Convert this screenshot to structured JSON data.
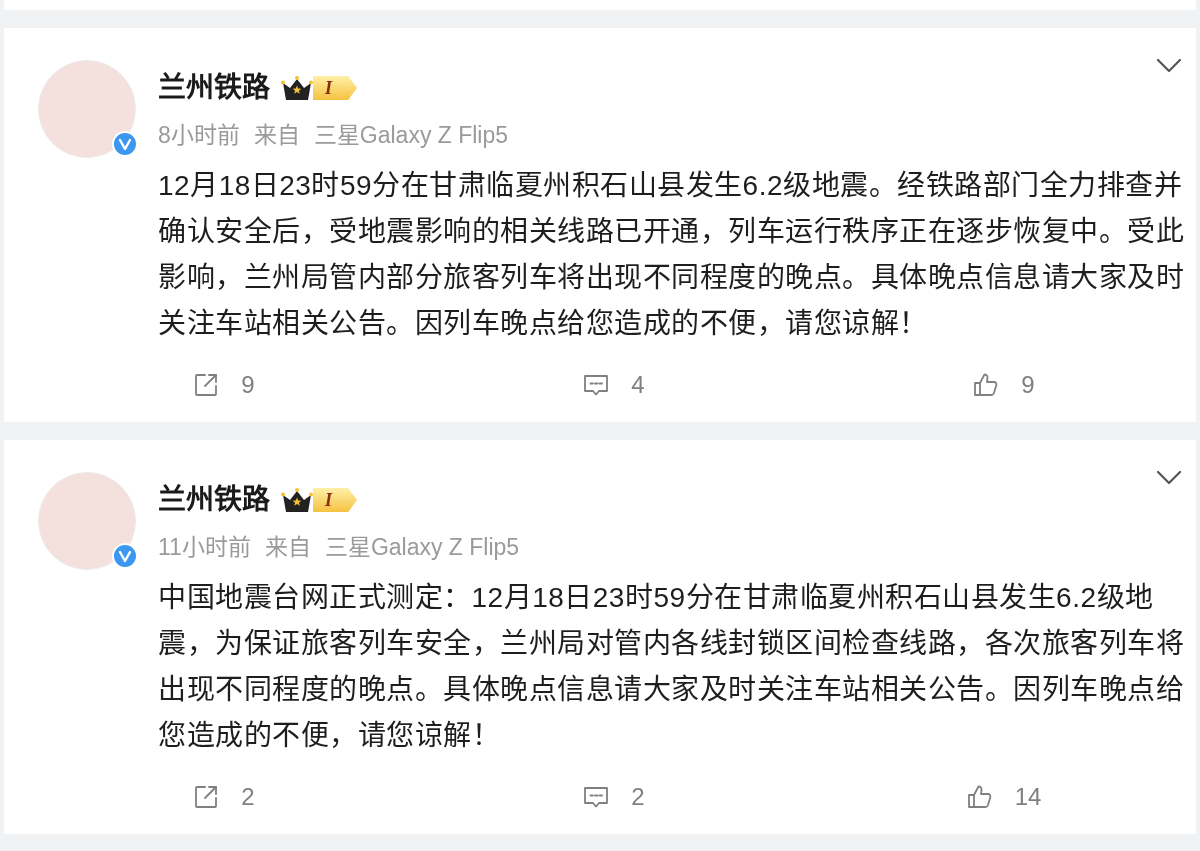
{
  "posts": [
    {
      "author": "兰州铁路",
      "level_badge": "I",
      "verified": true,
      "time": "8小时前",
      "source_label": "来自",
      "source": "三星Galaxy Z Flip5",
      "text": "12月18日23时59分在甘肃临夏州积石山县发生6.2级地震。经铁路部门全力排查并确认安全后，受地震影响的相关线路已开通，列车运行秩序正在逐步恢复中。受此影响，兰州局管内部分旅客列车将出现不同程度的晚点。具体晚点信息请大家及时关注车站相关公告。因列车晚点给您造成的不便，请您谅解！",
      "actions": [
        {
          "kind": "repost",
          "count": "9"
        },
        {
          "kind": "comment",
          "count": "4"
        },
        {
          "kind": "like",
          "count": "9"
        }
      ]
    },
    {
      "author": "兰州铁路",
      "level_badge": "I",
      "verified": true,
      "time": "11小时前",
      "source_label": "来自",
      "source": "三星Galaxy Z Flip5",
      "text": "中国地震台网正式测定：12月18日23时59分在甘肃临夏州积石山县发生6.2级地震，为保证旅客列车安全，兰州局对管内各线封锁区间检查线路，各次旅客列车将出现不同程度的晚点。具体晚点信息请大家及时关注车站相关公告。因列车晚点给您造成的不便，请您谅解！",
      "actions": [
        {
          "kind": "repost",
          "count": "2"
        },
        {
          "kind": "comment",
          "count": "2"
        },
        {
          "kind": "like",
          "count": "14"
        }
      ]
    }
  ]
}
